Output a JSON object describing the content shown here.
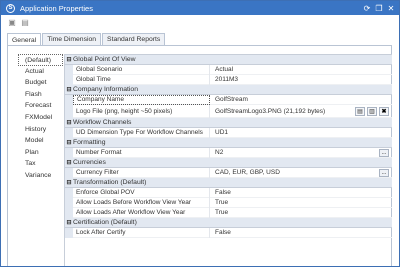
{
  "window": {
    "title": "Application Properties",
    "accent": "#3a75c4"
  },
  "tabs": [
    {
      "label": "General"
    },
    {
      "label": "Time Dimension"
    },
    {
      "label": "Standard Reports"
    }
  ],
  "left_list": [
    {
      "label": "(Default)"
    },
    {
      "label": "Actual"
    },
    {
      "label": "Budget"
    },
    {
      "label": "Flash"
    },
    {
      "label": "Forecast"
    },
    {
      "label": "FXModel"
    },
    {
      "label": "History"
    },
    {
      "label": "Model"
    },
    {
      "label": "Plan"
    },
    {
      "label": "Tax"
    },
    {
      "label": "Variance"
    }
  ],
  "groups": [
    {
      "header": "Global Point Of View",
      "rows": [
        {
          "name": "Global Scenario",
          "value": "Actual"
        },
        {
          "name": "Global Time",
          "value": "2011M3"
        }
      ]
    },
    {
      "header": "Company Information",
      "rows": [
        {
          "name": "Company Name",
          "value": "GolfStream"
        },
        {
          "name": "Logo File (png, height ~50 pixels)",
          "value": "GolfStreamLogo3.PNG (21,192 bytes)"
        }
      ]
    },
    {
      "header": "Workflow Channels",
      "rows": [
        {
          "name": "UD Dimension Type For Workflow Channels",
          "value": "UD1"
        }
      ]
    },
    {
      "header": "Formatting",
      "rows": [
        {
          "name": "Number Format",
          "value": "N2"
        }
      ]
    },
    {
      "header": "Currencies",
      "rows": [
        {
          "name": "Currency Filter",
          "value": "CAD, EUR, GBP, USD"
        }
      ]
    },
    {
      "header": "Transformation (Default)",
      "rows": [
        {
          "name": "Enforce Global POV",
          "value": "False"
        },
        {
          "name": "Allow Loads Before Workflow View Year",
          "value": "True"
        },
        {
          "name": "Allow Loads After Workflow View Year",
          "value": "True"
        }
      ]
    },
    {
      "header": "Certification (Default)",
      "rows": [
        {
          "name": "Lock After Certify",
          "value": "False"
        }
      ]
    }
  ],
  "buttons": {
    "ellipsis": "..."
  },
  "icons": {
    "app": "S",
    "refresh": "⟳",
    "restore": "❐",
    "close": "✕",
    "save": "▣",
    "save_as": "▤",
    "expand": "⊟",
    "open_file": "▤",
    "save_file": "▥",
    "delete": "✖"
  }
}
